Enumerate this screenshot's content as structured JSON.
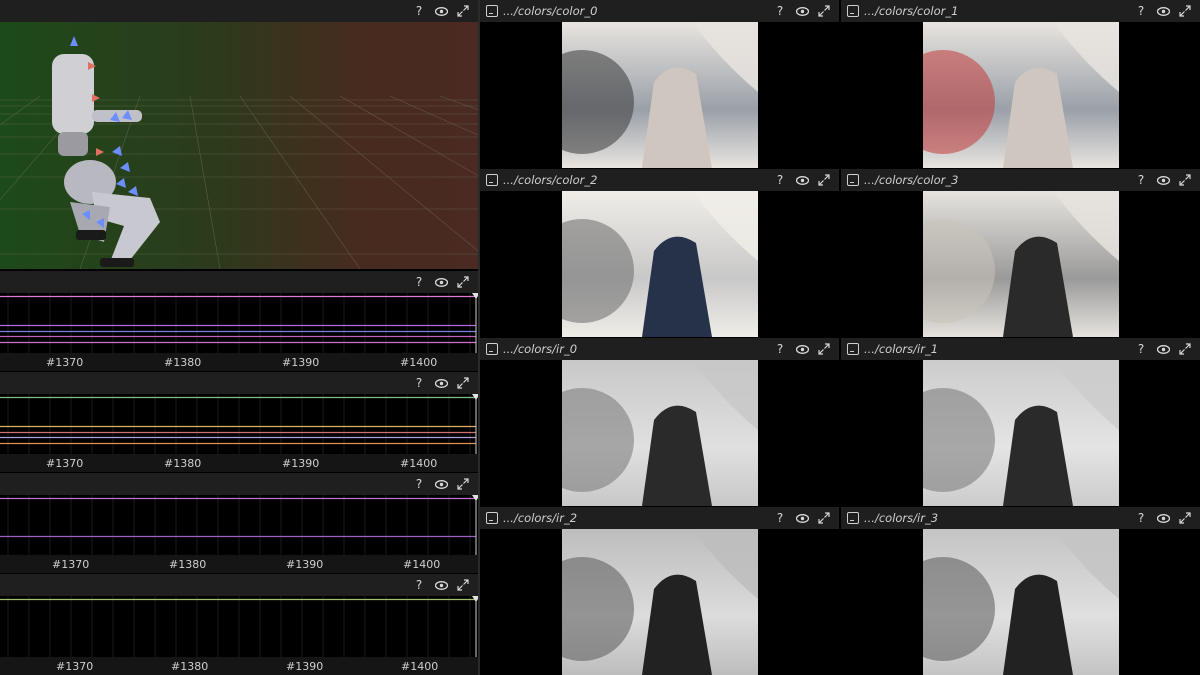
{
  "spatial_view": {
    "name": "3D robot view",
    "colors": {
      "background_left": "#1d4a1a",
      "background_right": "#4a2a22",
      "grid": "#6b6b55"
    }
  },
  "time_series_panels": [
    {
      "ticks": [
        "#1370",
        "#1380",
        "#1390",
        "#1400"
      ],
      "line_colors": [
        "#e07ad8",
        "#b46ae0",
        "#7d7de0",
        "#c060c0",
        "#d070d0"
      ]
    },
    {
      "ticks": [
        "#1370",
        "#1380",
        "#1390",
        "#1400"
      ],
      "line_colors": [
        "#80c080",
        "#e0b060",
        "#d07070",
        "#b0a0e0",
        "#e09050"
      ]
    },
    {
      "ticks": [
        "#1370",
        "#1380",
        "#1390",
        "#1400"
      ],
      "line_colors": [
        "#c070d0",
        "#a060c0"
      ]
    },
    {
      "ticks": [
        "#1370",
        "#1380",
        "#1390",
        "#1400"
      ],
      "line_colors": [
        "#a0c070"
      ]
    }
  ],
  "image_panels": [
    {
      "title": ".../colors/color_0"
    },
    {
      "title": ".../colors/color_1"
    },
    {
      "title": ".../colors/color_2"
    },
    {
      "title": ".../colors/color_3"
    },
    {
      "title": ".../colors/ir_0"
    },
    {
      "title": ".../colors/ir_1"
    },
    {
      "title": ".../colors/ir_2"
    },
    {
      "title": ".../colors/ir_3"
    }
  ],
  "header_icons": [
    "help-icon",
    "eye-icon",
    "maximize-icon"
  ],
  "help_glyph": "?"
}
